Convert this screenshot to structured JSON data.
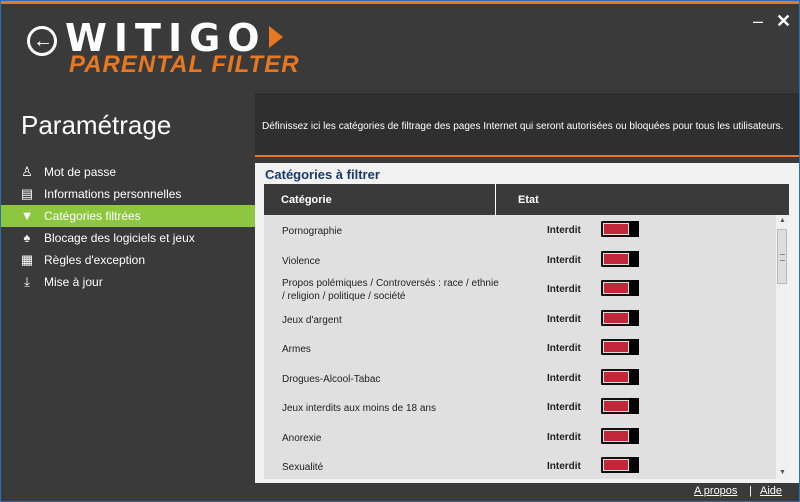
{
  "header": {
    "brand": "WITIGO",
    "product": "PARENTAL FILTER",
    "minimize_glyph": "–",
    "close_glyph": "✕"
  },
  "sidebar": {
    "title": "Paramétrage",
    "items": [
      {
        "label": "Mot de passe",
        "icon": "users-icon",
        "glyph": "♙"
      },
      {
        "label": "Informations personnelles",
        "icon": "database-icon",
        "glyph": "▤"
      },
      {
        "label": "Catégories filtrées",
        "icon": "filter-icon",
        "glyph": "▼"
      },
      {
        "label": "Blocage des logiciels et jeux",
        "icon": "gamepad-icon",
        "glyph": "♠"
      },
      {
        "label": "Règles d'exception",
        "icon": "calculator-icon",
        "glyph": "▦"
      },
      {
        "label": "Mise à jour",
        "icon": "download-icon",
        "glyph": "⤓"
      }
    ],
    "active_index": 2
  },
  "main": {
    "description": "Définissez ici les catégories de filtrage des pages Internet qui seront autorisées ou bloquées pour tous les utilisateurs.",
    "panel_title": "Catégories à filtrer",
    "col_category": "Catégorie",
    "col_state": "Etat",
    "rows": [
      {
        "label": "Pornographie",
        "state": "Interdit"
      },
      {
        "label": "Violence",
        "state": "Interdit"
      },
      {
        "label": "Propos polémiques / Controversés : race / ethnie / religion / politique / société",
        "state": "Interdit"
      },
      {
        "label": "Jeux d'argent",
        "state": "Interdit"
      },
      {
        "label": "Armes",
        "state": "Interdit"
      },
      {
        "label": "Drogues-Alcool-Tabac",
        "state": "Interdit"
      },
      {
        "label": "Jeux interdits aux moins de 18 ans",
        "state": "Interdit"
      },
      {
        "label": "Anorexie",
        "state": "Interdit"
      },
      {
        "label": "Sexualité",
        "state": "Interdit"
      }
    ]
  },
  "footer": {
    "about": "A propos",
    "separator": "|",
    "help": "Aide"
  },
  "colors": {
    "accent": "#e87722",
    "active_nav": "#8dc63f",
    "toggle_blocked": "#c0283a",
    "background": "#3a3a3a"
  }
}
